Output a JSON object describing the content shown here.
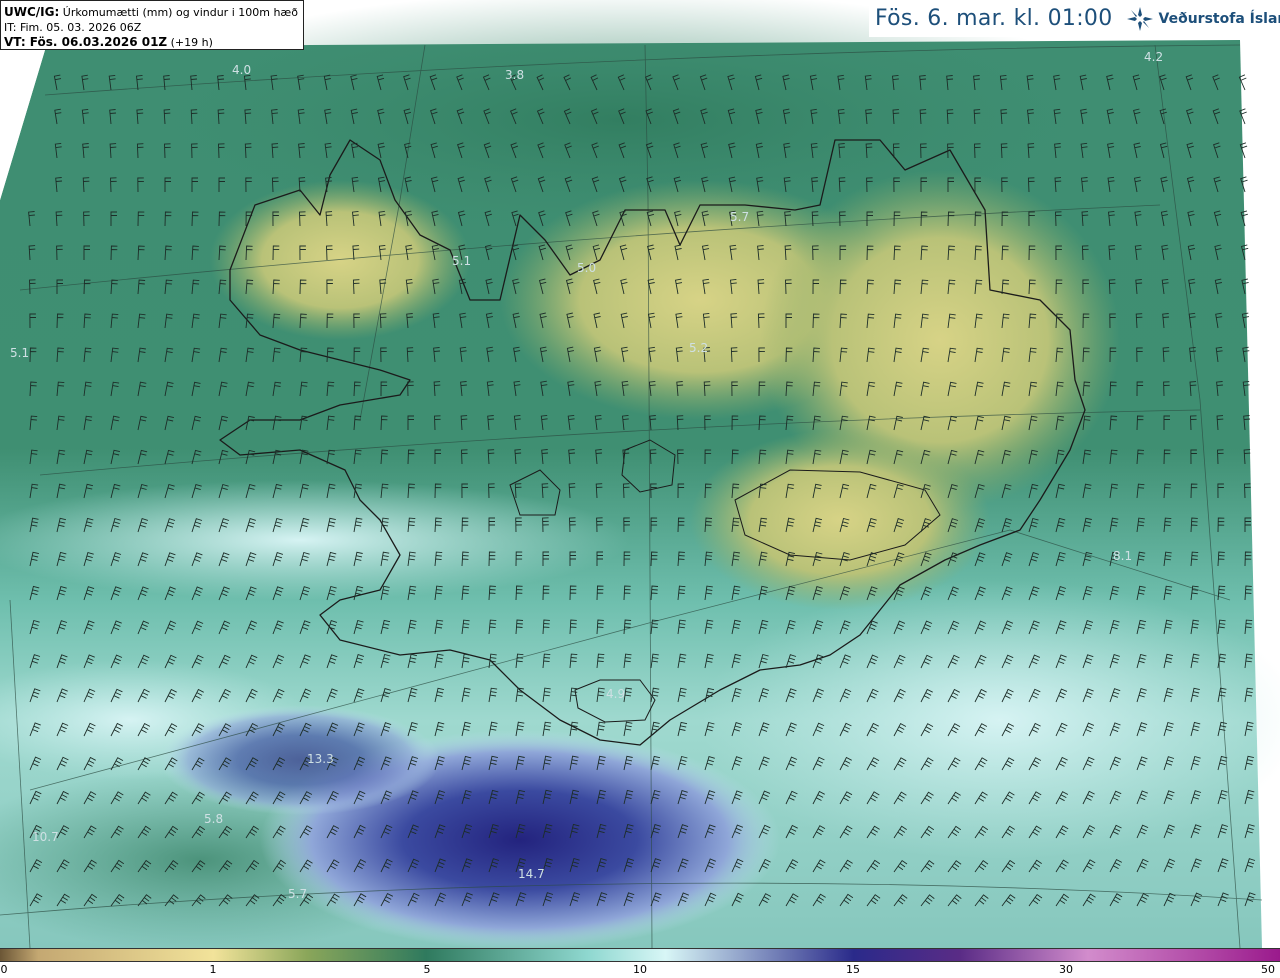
{
  "header": {
    "model_name": "UWC/IG:",
    "field_description": "Úrkomumætti (mm) og vindur i 100m hæð",
    "initial_time": "IT: Fim. 05. 03. 2026 06Z",
    "valid_time_label": "VT: Fös. 06.03.2026 01Z",
    "lead_time": "(+19 h)"
  },
  "title": {
    "text": "Fös. 6. mar. kl. 01:00",
    "logo_text": "Veðurstofa Íslands",
    "logo_icon": "vedurstofa-logo-icon"
  },
  "value_labels": [
    {
      "text": "4.0"
    },
    {
      "text": "3.8"
    },
    {
      "text": "4.2"
    },
    {
      "text": "5.7"
    },
    {
      "text": "5.1"
    },
    {
      "text": "5.0"
    },
    {
      "text": "5.1"
    },
    {
      "text": "5.2"
    },
    {
      "text": "8.1"
    },
    {
      "text": "4.9"
    },
    {
      "text": "13.3"
    },
    {
      "text": "5.8"
    },
    {
      "text": "10.7"
    },
    {
      "text": "14.7"
    },
    {
      "text": "5.7"
    }
  ],
  "colorbar": {
    "ticks": [
      "0",
      "1",
      "5",
      "10",
      "15",
      "30",
      "50"
    ],
    "colors": [
      "#6b5636",
      "#c4a872",
      "#f2e39a",
      "#8aa65a",
      "#2f7a5e",
      "#8fd8d0",
      "#d8f6f6",
      "#2a2a8a",
      "#5a2c86",
      "#d28ccc",
      "#9a1a8c"
    ]
  }
}
